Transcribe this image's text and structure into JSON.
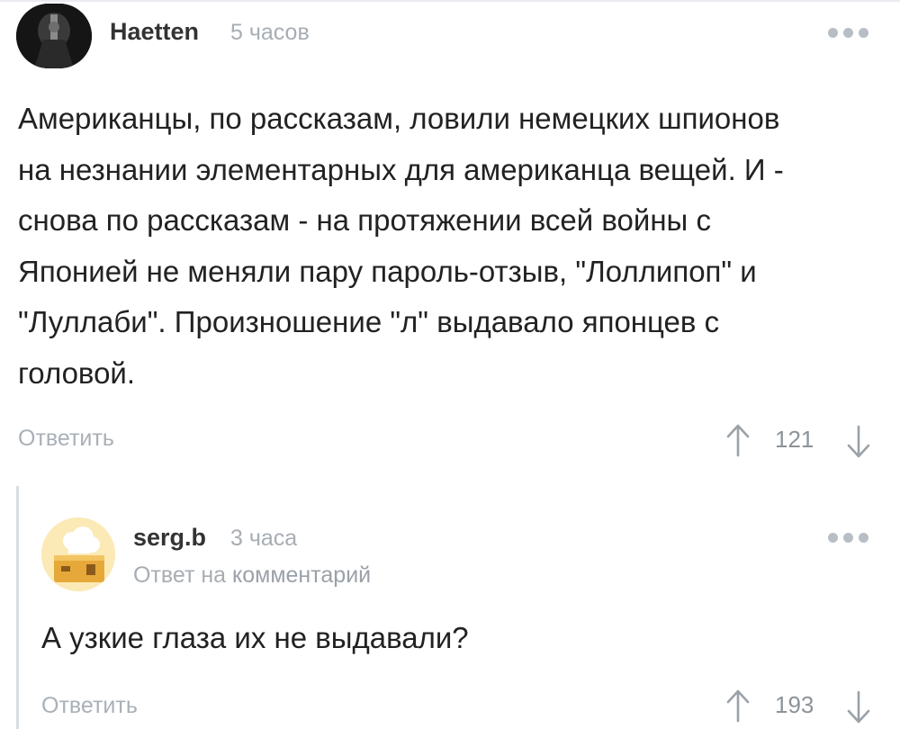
{
  "comments": [
    {
      "username": "Haetten",
      "time": "5 часов",
      "text": "Американцы, по рассказам, ловили немецких шпионов\nна незнании элементарных для американца вещей. И -\nснова по рассказам - на протяжении всей войны с\nЯпонией не меняли пару пароль-отзыв, \"Лоллипоп\" и\n\"Луллаби\". Произношение \"л\" выдавало японцев с\nголовой.",
      "reply_label": "Ответить",
      "rating": "121"
    },
    {
      "username": "serg.b",
      "time": "3 часа",
      "answer_prefix": "Ответ на",
      "answer_link": "комментарий",
      "text": "А узкие глаза их не выдавали?",
      "reply_label": "Ответить",
      "rating": "193"
    }
  ],
  "icons": {
    "more": "more-dots-icon",
    "upvote": "arrow-up-icon",
    "downvote": "arrow-down-icon"
  },
  "colors": {
    "muted_text": "#a7adb3",
    "dots": "#b8bec5",
    "thread_line": "#d9dde1"
  }
}
